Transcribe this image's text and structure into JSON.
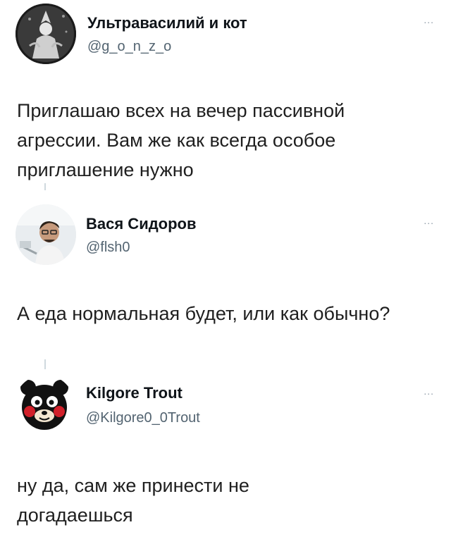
{
  "tweets": [
    {
      "display_name": "Ультравасилий и кот",
      "handle": "@g_o_n_z_o",
      "more_label": "...",
      "text": "Приглашаю всех на вечер пассивной агрессии. Вам же как всегда особое приглашение нужно"
    },
    {
      "display_name": "Вася Сидоров",
      "handle": "@flsh0",
      "more_label": "...",
      "text": "А еда нормальная будет, или как обычно?"
    },
    {
      "display_name": "Kilgore Trout",
      "handle": "@Kilgore0_0Trout",
      "more_label": "...",
      "text": "ну да, сам же принести не догадаешься"
    }
  ]
}
